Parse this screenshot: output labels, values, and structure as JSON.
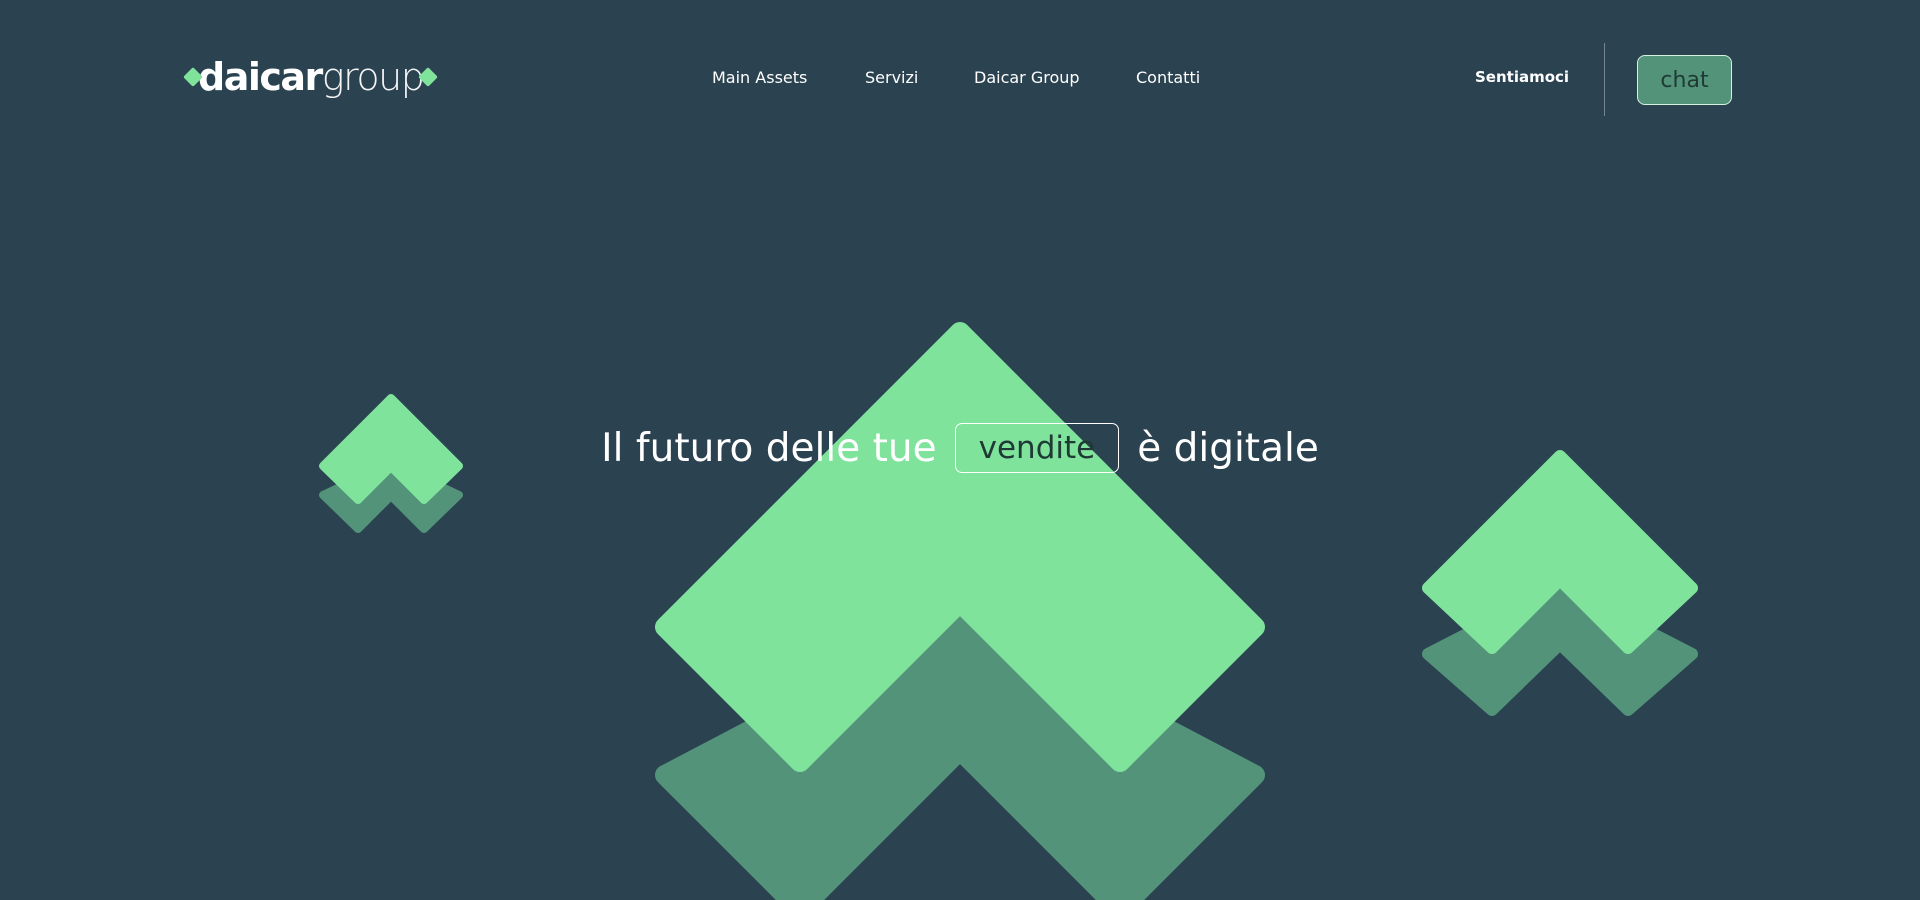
{
  "logo": {
    "bold_text": "daicar",
    "light_text": "group",
    "accent_color": "#7fe39c"
  },
  "nav": {
    "items": [
      {
        "label": "Main Assets"
      },
      {
        "label": "Servizi"
      },
      {
        "label": "Daicar Group"
      },
      {
        "label": "Contatti"
      }
    ]
  },
  "header": {
    "cta_label": "Sentiamoci",
    "chat_label": "chat"
  },
  "hero": {
    "text_before": "Il futuro delle tue",
    "highlight": "vendite",
    "text_after": "è digitale"
  },
  "colors": {
    "background": "#2b4250",
    "chevron_light": "#7fe39c",
    "chevron_dark": "#53937a"
  }
}
